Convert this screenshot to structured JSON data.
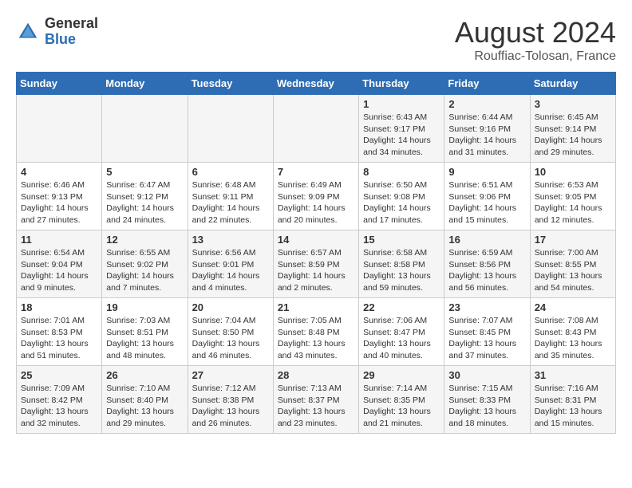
{
  "header": {
    "logo_general": "General",
    "logo_blue": "Blue",
    "title": "August 2024",
    "location": "Rouffiac-Tolosan, France"
  },
  "days_of_week": [
    "Sunday",
    "Monday",
    "Tuesday",
    "Wednesday",
    "Thursday",
    "Friday",
    "Saturday"
  ],
  "weeks": [
    [
      {
        "day": "",
        "info": ""
      },
      {
        "day": "",
        "info": ""
      },
      {
        "day": "",
        "info": ""
      },
      {
        "day": "",
        "info": ""
      },
      {
        "day": "1",
        "info": "Sunrise: 6:43 AM\nSunset: 9:17 PM\nDaylight: 14 hours\nand 34 minutes."
      },
      {
        "day": "2",
        "info": "Sunrise: 6:44 AM\nSunset: 9:16 PM\nDaylight: 14 hours\nand 31 minutes."
      },
      {
        "day": "3",
        "info": "Sunrise: 6:45 AM\nSunset: 9:14 PM\nDaylight: 14 hours\nand 29 minutes."
      }
    ],
    [
      {
        "day": "4",
        "info": "Sunrise: 6:46 AM\nSunset: 9:13 PM\nDaylight: 14 hours\nand 27 minutes."
      },
      {
        "day": "5",
        "info": "Sunrise: 6:47 AM\nSunset: 9:12 PM\nDaylight: 14 hours\nand 24 minutes."
      },
      {
        "day": "6",
        "info": "Sunrise: 6:48 AM\nSunset: 9:11 PM\nDaylight: 14 hours\nand 22 minutes."
      },
      {
        "day": "7",
        "info": "Sunrise: 6:49 AM\nSunset: 9:09 PM\nDaylight: 14 hours\nand 20 minutes."
      },
      {
        "day": "8",
        "info": "Sunrise: 6:50 AM\nSunset: 9:08 PM\nDaylight: 14 hours\nand 17 minutes."
      },
      {
        "day": "9",
        "info": "Sunrise: 6:51 AM\nSunset: 9:06 PM\nDaylight: 14 hours\nand 15 minutes."
      },
      {
        "day": "10",
        "info": "Sunrise: 6:53 AM\nSunset: 9:05 PM\nDaylight: 14 hours\nand 12 minutes."
      }
    ],
    [
      {
        "day": "11",
        "info": "Sunrise: 6:54 AM\nSunset: 9:04 PM\nDaylight: 14 hours\nand 9 minutes."
      },
      {
        "day": "12",
        "info": "Sunrise: 6:55 AM\nSunset: 9:02 PM\nDaylight: 14 hours\nand 7 minutes."
      },
      {
        "day": "13",
        "info": "Sunrise: 6:56 AM\nSunset: 9:01 PM\nDaylight: 14 hours\nand 4 minutes."
      },
      {
        "day": "14",
        "info": "Sunrise: 6:57 AM\nSunset: 8:59 PM\nDaylight: 14 hours\nand 2 minutes."
      },
      {
        "day": "15",
        "info": "Sunrise: 6:58 AM\nSunset: 8:58 PM\nDaylight: 13 hours\nand 59 minutes."
      },
      {
        "day": "16",
        "info": "Sunrise: 6:59 AM\nSunset: 8:56 PM\nDaylight: 13 hours\nand 56 minutes."
      },
      {
        "day": "17",
        "info": "Sunrise: 7:00 AM\nSunset: 8:55 PM\nDaylight: 13 hours\nand 54 minutes."
      }
    ],
    [
      {
        "day": "18",
        "info": "Sunrise: 7:01 AM\nSunset: 8:53 PM\nDaylight: 13 hours\nand 51 minutes."
      },
      {
        "day": "19",
        "info": "Sunrise: 7:03 AM\nSunset: 8:51 PM\nDaylight: 13 hours\nand 48 minutes."
      },
      {
        "day": "20",
        "info": "Sunrise: 7:04 AM\nSunset: 8:50 PM\nDaylight: 13 hours\nand 46 minutes."
      },
      {
        "day": "21",
        "info": "Sunrise: 7:05 AM\nSunset: 8:48 PM\nDaylight: 13 hours\nand 43 minutes."
      },
      {
        "day": "22",
        "info": "Sunrise: 7:06 AM\nSunset: 8:47 PM\nDaylight: 13 hours\nand 40 minutes."
      },
      {
        "day": "23",
        "info": "Sunrise: 7:07 AM\nSunset: 8:45 PM\nDaylight: 13 hours\nand 37 minutes."
      },
      {
        "day": "24",
        "info": "Sunrise: 7:08 AM\nSunset: 8:43 PM\nDaylight: 13 hours\nand 35 minutes."
      }
    ],
    [
      {
        "day": "25",
        "info": "Sunrise: 7:09 AM\nSunset: 8:42 PM\nDaylight: 13 hours\nand 32 minutes."
      },
      {
        "day": "26",
        "info": "Sunrise: 7:10 AM\nSunset: 8:40 PM\nDaylight: 13 hours\nand 29 minutes."
      },
      {
        "day": "27",
        "info": "Sunrise: 7:12 AM\nSunset: 8:38 PM\nDaylight: 13 hours\nand 26 minutes."
      },
      {
        "day": "28",
        "info": "Sunrise: 7:13 AM\nSunset: 8:37 PM\nDaylight: 13 hours\nand 23 minutes."
      },
      {
        "day": "29",
        "info": "Sunrise: 7:14 AM\nSunset: 8:35 PM\nDaylight: 13 hours\nand 21 minutes."
      },
      {
        "day": "30",
        "info": "Sunrise: 7:15 AM\nSunset: 8:33 PM\nDaylight: 13 hours\nand 18 minutes."
      },
      {
        "day": "31",
        "info": "Sunrise: 7:16 AM\nSunset: 8:31 PM\nDaylight: 13 hours\nand 15 minutes."
      }
    ]
  ]
}
